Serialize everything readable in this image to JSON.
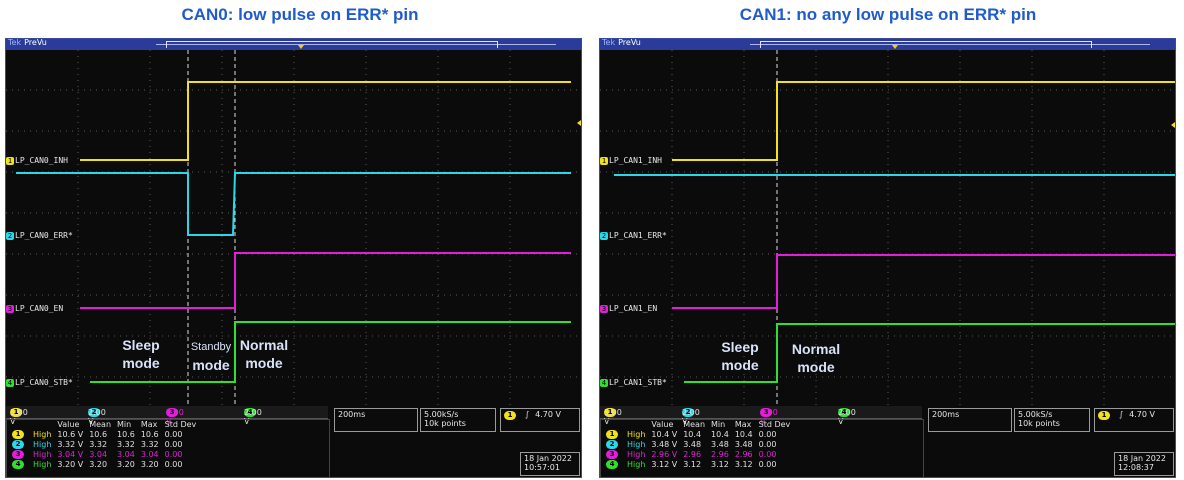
{
  "captions": {
    "left": "CAN0: low pulse on ERR* pin",
    "right": "CAN1: no any low pulse on ERR* pin"
  },
  "colors": {
    "caption": "#1f5bc9",
    "ch1": "#f0e020",
    "ch2": "#2ad8e8",
    "ch3": "#e020d8",
    "ch4": "#30e030"
  },
  "scopes": [
    {
      "brand": "Tek",
      "status": "PreVu",
      "labels": {
        "ch1": "LP_CAN0_INH",
        "ch2": "LP_CAN0_ERR*",
        "ch3": "LP_CAN0_EN",
        "ch4": "LP_CAN0_STB*"
      },
      "modes": {
        "sleep": [
          "Sleep",
          "mode"
        ],
        "standby": [
          "Standby",
          "mode"
        ],
        "normal": [
          "Normal",
          "mode"
        ]
      },
      "scale": {
        "ch1": "5.00 V",
        "ch2": "2.00 V",
        "ch3": "2.00 V",
        "ch4": "2.00 V"
      },
      "measurements": {
        "headers": [
          "Value",
          "Mean",
          "Min",
          "Max",
          "Std Dev"
        ],
        "rows": [
          {
            "ch": "1",
            "label": "High",
            "value": "10.6 V",
            "mean": "10.6",
            "min": "10.6",
            "max": "10.6",
            "std": "0.00"
          },
          {
            "ch": "2",
            "label": "High",
            "value": "3.32 V",
            "mean": "3.32",
            "min": "3.32",
            "max": "3.32",
            "std": "0.00"
          },
          {
            "ch": "3",
            "label": "High",
            "value": "3.04 V",
            "mean": "3.04",
            "min": "3.04",
            "max": "3.04",
            "std": "0.00"
          },
          {
            "ch": "4",
            "label": "High",
            "value": "3.20 V",
            "mean": "3.20",
            "min": "3.20",
            "max": "3.20",
            "std": "0.00"
          }
        ]
      },
      "timebase": "200ms",
      "sample_rate": "5.00kS/s",
      "record_length": "10k points",
      "trigger": {
        "ch": "1",
        "slope": "∫",
        "level": "4.70 V"
      },
      "date": "18 Jan  2022",
      "time": "10:57:01"
    },
    {
      "brand": "Tek",
      "status": "PreVu",
      "labels": {
        "ch1": "LP_CAN1_INH",
        "ch2": "LP_CAN1_ERR*",
        "ch3": "LP_CAN1_EN",
        "ch4": "LP_CAN1_STB*"
      },
      "modes": {
        "sleep": [
          "Sleep",
          "mode"
        ],
        "normal": [
          "Normal",
          "mode"
        ]
      },
      "scale": {
        "ch1": "5.00 V",
        "ch2": "2.00 V",
        "ch3": "2.00 V",
        "ch4": "2.00 V"
      },
      "measurements": {
        "headers": [
          "Value",
          "Mean",
          "Min",
          "Max",
          "Std Dev"
        ],
        "rows": [
          {
            "ch": "1",
            "label": "High",
            "value": "10.4 V",
            "mean": "10.4",
            "min": "10.4",
            "max": "10.4",
            "std": "0.00"
          },
          {
            "ch": "2",
            "label": "High",
            "value": "3.48 V",
            "mean": "3.48",
            "min": "3.48",
            "max": "3.48",
            "std": "0.00"
          },
          {
            "ch": "3",
            "label": "High",
            "value": "2.96 V",
            "mean": "2.96",
            "min": "2.96",
            "max": "2.96",
            "std": "0.00"
          },
          {
            "ch": "4",
            "label": "High",
            "value": "3.12 V",
            "mean": "3.12",
            "min": "3.12",
            "max": "3.12",
            "std": "0.00"
          }
        ]
      },
      "timebase": "200ms",
      "sample_rate": "5.00kS/s",
      "record_length": "10k points",
      "trigger": {
        "ch": "1",
        "slope": "∫",
        "level": "4.70 V"
      },
      "date": "18 Jan  2022",
      "time": "12:08:37"
    }
  ]
}
